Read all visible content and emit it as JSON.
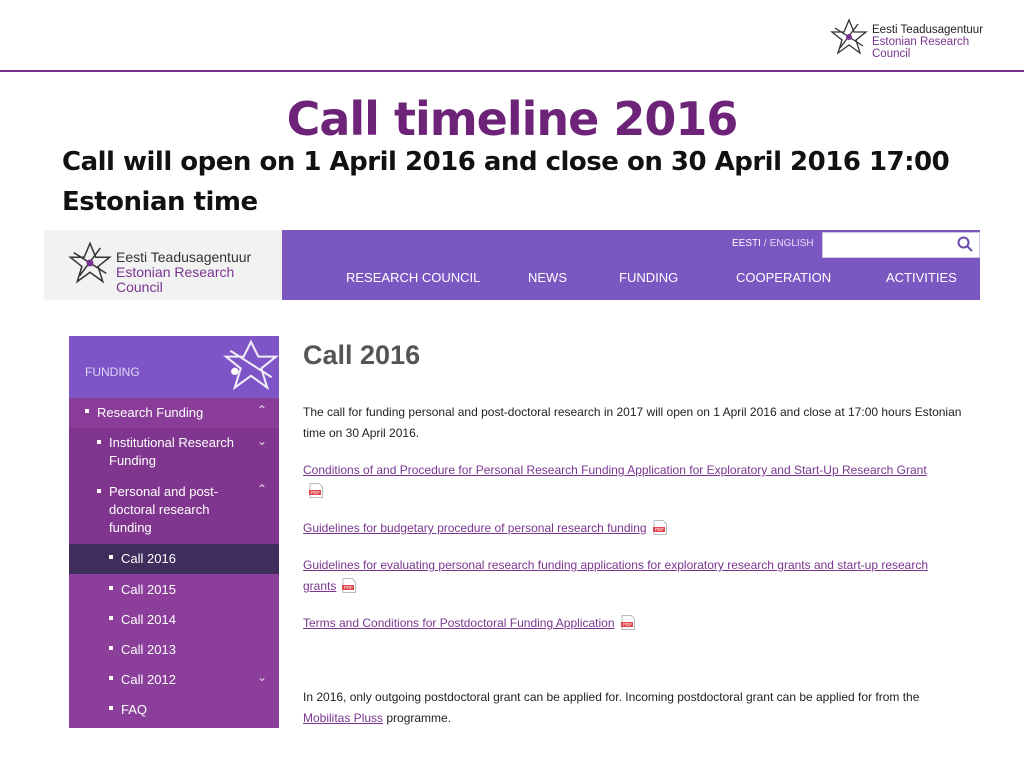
{
  "slide": {
    "logo_line1": "Eesti Teadusagentuur",
    "logo_line2": "Estonian Research Council",
    "title": "Call timeline 2016",
    "subtitle": "Call will open on 1 April 2016 and close on 30 April 2016 17:00 Estonian time"
  },
  "site": {
    "logo_line1": "Eesti Teadusagentuur",
    "logo_line2": "Estonian Research Council",
    "lang_et": "EESTI",
    "lang_sep": "/",
    "lang_en": "ENGLISH",
    "search_placeholder": "",
    "nav": [
      "RESEARCH COUNCIL",
      "NEWS",
      "FUNDING",
      "COOPERATION",
      "ACTIVITIES"
    ]
  },
  "sidebar": {
    "heading": "FUNDING",
    "items": [
      {
        "label": "Research Funding",
        "level": 1,
        "chevron": "up"
      },
      {
        "label": "Institutional Research Funding",
        "level": 2,
        "chevron": "down"
      },
      {
        "label": "Personal and post-doctoral research funding",
        "level": 2,
        "chevron": "up"
      },
      {
        "label": "Call 2016",
        "level": 3,
        "active": true
      },
      {
        "label": "Call 2015",
        "level": 3
      },
      {
        "label": "Call 2014",
        "level": 3
      },
      {
        "label": "Call 2013",
        "level": 3
      },
      {
        "label": "Call 2012",
        "level": 3,
        "chevron": "down"
      },
      {
        "label": "FAQ",
        "level": 3
      }
    ]
  },
  "content": {
    "title": "Call 2016",
    "intro": "The call for funding personal and post-doctoral research in 2017 will open on 1 April 2016 and close at 17:00 hours Estonian time on 30 April 2016.",
    "links": [
      "Conditions of and Procedure for Personal Research Funding Application for Exploratory and Start-Up Research Grant",
      "Guidelines for budgetary procedure of personal research funding",
      "Guidelines for evaluating personal research funding applications for exploratory research grants and start-up research grants",
      "Terms and Conditions for Postdoctoral Funding Application"
    ],
    "note_text": "In 2016, only outgoing postdoctoral grant can be applied for. Incoming postdoctoral grant can be applied for from the",
    "note_link": "Mobilitas Pluss",
    "note_tail": " programme."
  },
  "colors": {
    "brand_purple": "#7a2f88",
    "nav_purple": "#7b57c2",
    "sidebar_purple": "#8b3e9a",
    "active_item": "#3f2d5c"
  },
  "icons": {
    "logo": "star-network-icon",
    "search": "search-icon",
    "pdf": "pdf-file-icon",
    "chevron_up": "chevron-up-icon",
    "chevron_down": "chevron-down-icon"
  }
}
